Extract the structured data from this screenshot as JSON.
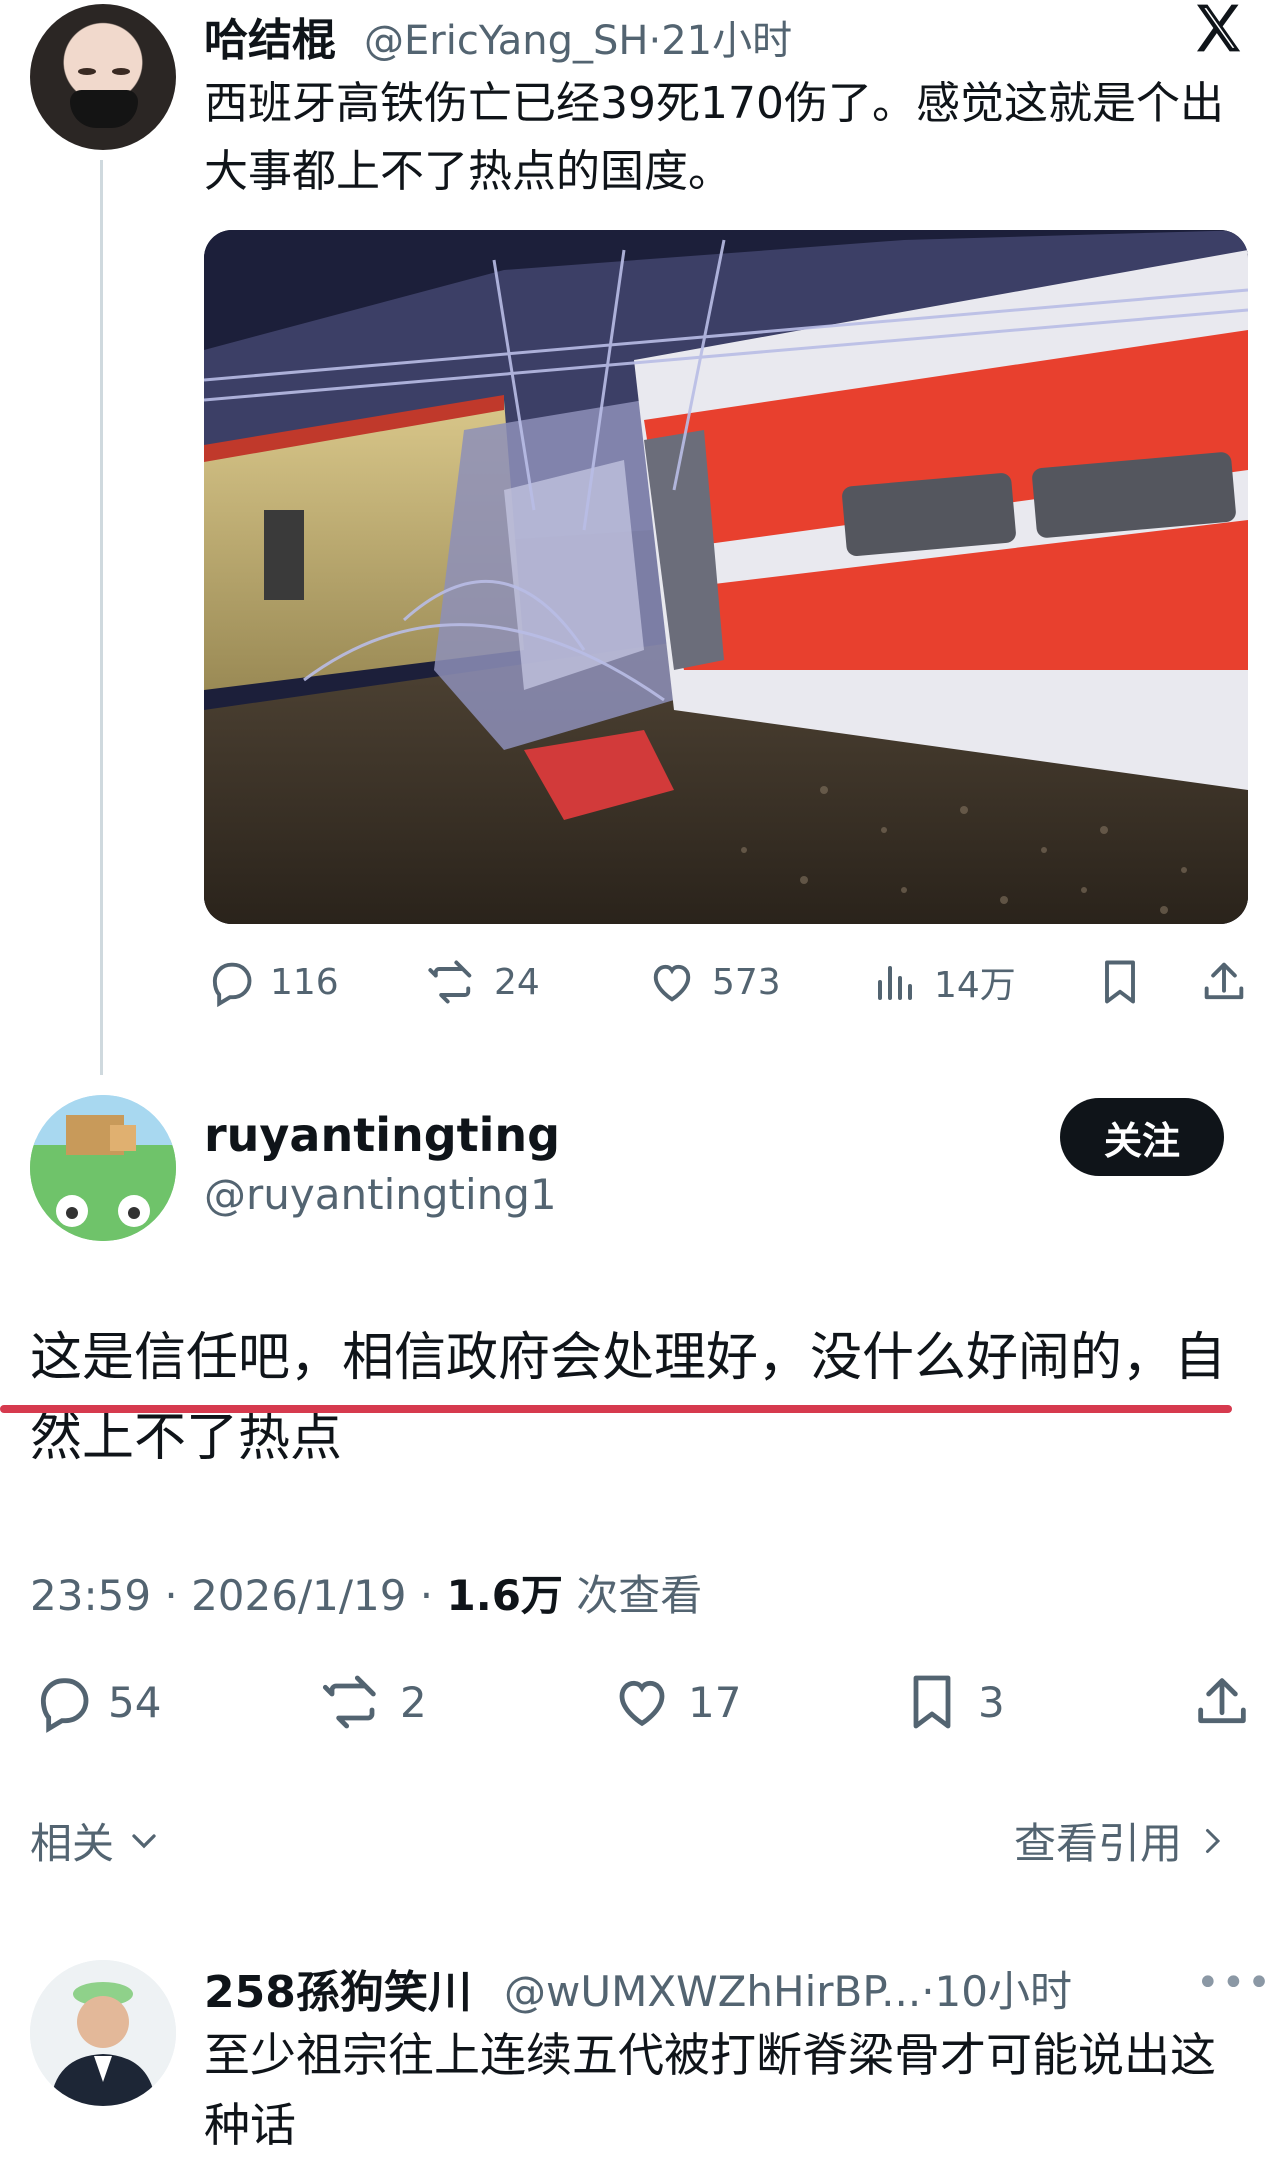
{
  "tweet": {
    "author": "哈结棍",
    "handle": "@EricYang_SH",
    "time": "·21小时",
    "text": "西班牙高铁伤亡已经39死170伤了。感觉这就是个出大事都上不了热点的国度。",
    "stats": {
      "replies": "116",
      "retweets": "24",
      "likes": "573",
      "views": "14万"
    }
  },
  "reply": {
    "author": "ruyantingting",
    "handle": "@ruyantingting1",
    "follow_label": "关注",
    "text": "这是信任吧，相信政府会处理好，没什么好闹的，自然上不了热点",
    "time": "23:59 · 2026/1/19 ·",
    "views_count": "1.6万",
    "views_label": "次查看",
    "stats": {
      "replies": "54",
      "retweets": "2",
      "likes": "17",
      "bookmarks": "3"
    }
  },
  "related_label": "相关",
  "quotes_label": "查看引用",
  "comment": {
    "author": "258孫狗笑川",
    "handle": "@wUMXWZhHirBP...",
    "time": "·10小时",
    "text": "至少祖宗往上连续五代被打断脊梁骨才可能说出这种话"
  },
  "colors": {
    "accent_line": "#d63a4e",
    "muted": "#536471",
    "follow_bg": "#0f1419"
  }
}
